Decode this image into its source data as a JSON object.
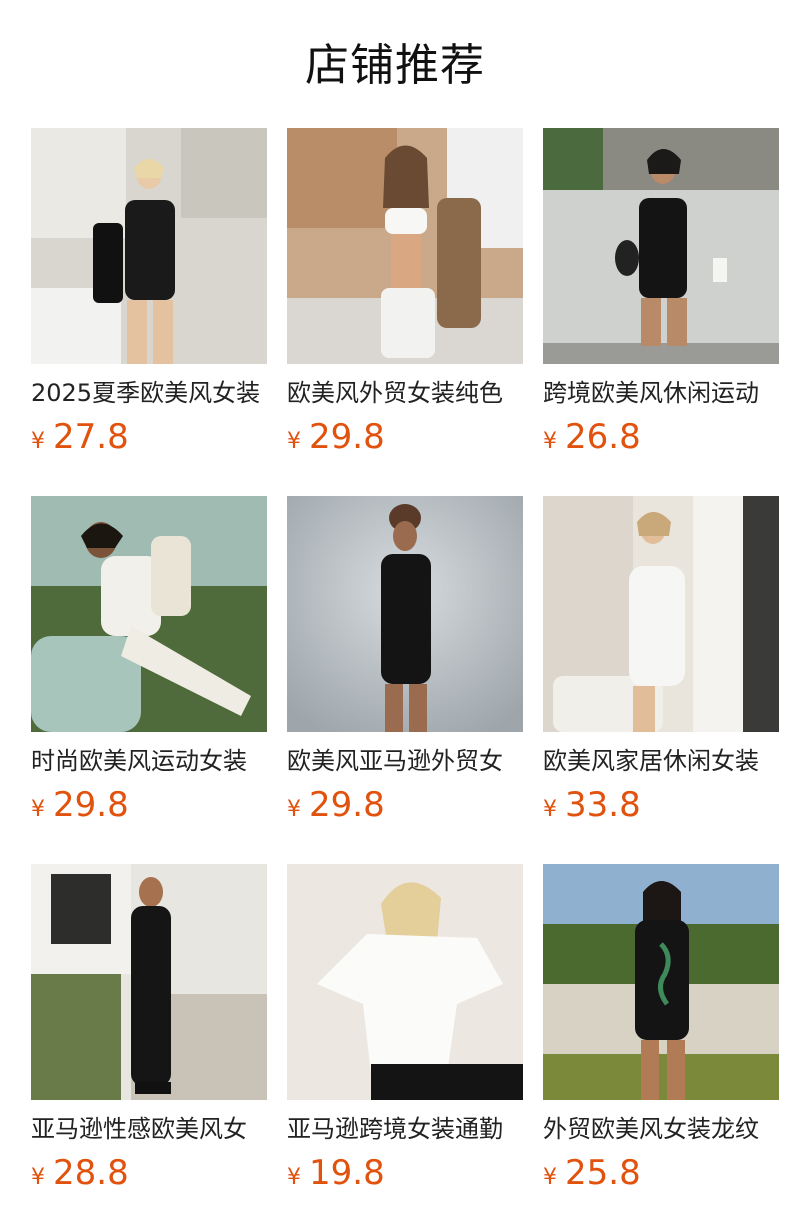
{
  "header": {
    "title": "店铺推荐"
  },
  "products": [
    {
      "name": "2025夏季欧美风女装",
      "currency": "¥",
      "price": "27.8",
      "photo_icon": "product-photo"
    },
    {
      "name": "欧美风外贸女装纯色",
      "currency": "¥",
      "price": "29.8",
      "photo_icon": "product-photo"
    },
    {
      "name": "跨境欧美风休闲运动",
      "currency": "¥",
      "price": "26.8",
      "photo_icon": "product-photo"
    },
    {
      "name": "时尚欧美风运动女装",
      "currency": "¥",
      "price": "29.8",
      "photo_icon": "product-photo"
    },
    {
      "name": "欧美风亚马逊外贸女",
      "currency": "¥",
      "price": "29.8",
      "photo_icon": "product-photo"
    },
    {
      "name": "欧美风家居休闲女装",
      "currency": "¥",
      "price": "33.8",
      "photo_icon": "product-photo"
    },
    {
      "name": "亚马逊性感欧美风女",
      "currency": "¥",
      "price": "28.8",
      "photo_icon": "product-photo"
    },
    {
      "name": "亚马逊跨境女装通勤",
      "currency": "¥",
      "price": "19.8",
      "photo_icon": "product-photo"
    },
    {
      "name": "外贸欧美风女装龙纹",
      "currency": "¥",
      "price": "25.8",
      "photo_icon": "product-photo"
    }
  ],
  "theme": {
    "price_color": "#e1520e",
    "title_color": "#111111"
  }
}
